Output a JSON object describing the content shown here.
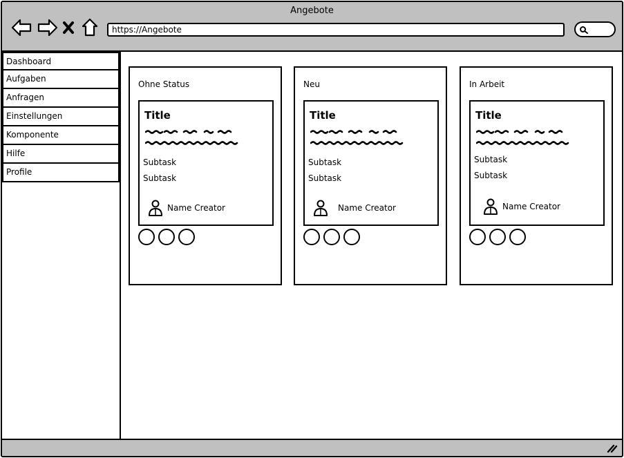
{
  "window": {
    "title": "Angebote"
  },
  "browser": {
    "url": "https://Angebote",
    "icons": [
      "back-arrow-icon",
      "forward-arrow-icon",
      "close-x-icon",
      "home-icon",
      "search-icon"
    ]
  },
  "sidebar": {
    "items": [
      {
        "label": "Dashboard"
      },
      {
        "label": "Aufgaben"
      },
      {
        "label": "Anfragen"
      },
      {
        "label": "Einstellungen"
      },
      {
        "label": "Komponente"
      },
      {
        "label": "Hilfe"
      },
      {
        "label": "Profile"
      }
    ]
  },
  "board": {
    "columns": [
      {
        "title": "Ohne Status",
        "card": {
          "title": "Title",
          "subtasks": [
            "Subtask",
            "Subtask"
          ],
          "creator": "Name Creator"
        }
      },
      {
        "title": "Neu",
        "card": {
          "title": "Title",
          "subtasks": [
            "Subtask",
            "Subtask"
          ],
          "creator": "Name Creator"
        }
      },
      {
        "title": "In Arbeit",
        "card": {
          "title": "Title",
          "subtasks": [
            "Subtask",
            "Subtask"
          ],
          "creator": "Name Creator"
        }
      }
    ]
  },
  "colors": {
    "chrome": "#c0c0c0",
    "border": "#000000",
    "background": "#ffffff"
  }
}
